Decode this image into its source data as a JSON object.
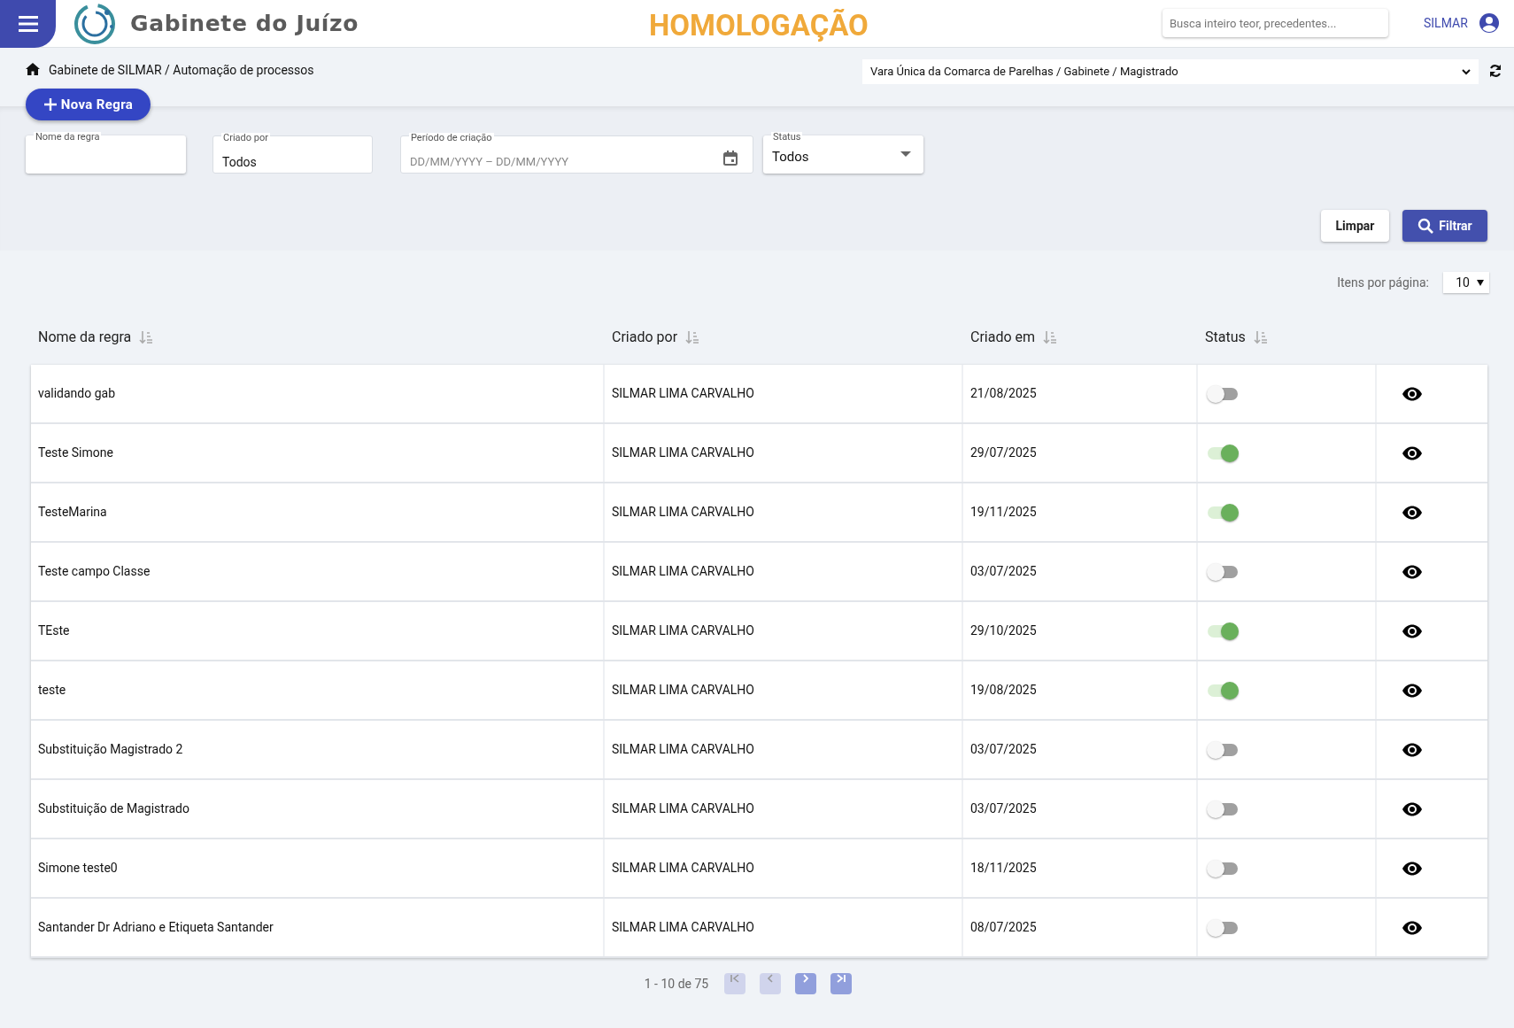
{
  "header": {
    "title": "Gabinete do Juízo",
    "environment": "HOMOLOGAÇÃO",
    "search": {
      "placeholder": "Busca inteiro teor, precedentes..."
    },
    "user": "SILMAR"
  },
  "breadcrumb": "Gabinete de SILMAR / Automação de processos",
  "unit_select": "Vara Única da Comarca de Parelhas / Gabinete / Magistrado",
  "new_button": "Nova Regra",
  "filters": [
    {
      "kind": "text",
      "label": "Nome da regra"
    },
    {
      "kind": "text",
      "label": "Criado por",
      "value": "Todos"
    },
    {
      "kind": "date",
      "label": "Período de criação",
      "placeholder": "DD/MM/YYYY – DD/MM/YYYY"
    },
    {
      "kind": "select",
      "label": "Status",
      "value": "Todos"
    }
  ],
  "actions": [
    "Limpar",
    "Filtrar"
  ],
  "page_size": {
    "label": "Itens por página:",
    "value": "10"
  },
  "table": {
    "columns": [
      "Nome da regra",
      "Criado por",
      "Criado em",
      "Status"
    ],
    "rows": [
      {
        "name": "validando gab",
        "creator": "SILMAR LIMA CARVALHO",
        "date": "21/08/2025",
        "on": false
      },
      {
        "name": "Teste Simone",
        "creator": "SILMAR LIMA CARVALHO",
        "date": "29/07/2025",
        "on": true
      },
      {
        "name": "TesteMarina",
        "creator": "SILMAR LIMA CARVALHO",
        "date": "19/11/2025",
        "on": true
      },
      {
        "name": "Teste campo Classe",
        "creator": "SILMAR LIMA CARVALHO",
        "date": "03/07/2025",
        "on": false
      },
      {
        "name": "TEste",
        "creator": "SILMAR LIMA CARVALHO",
        "date": "29/10/2025",
        "on": true
      },
      {
        "name": "teste",
        "creator": "SILMAR LIMA CARVALHO",
        "date": "19/08/2025",
        "on": true
      },
      {
        "name": "Substituição Magistrado 2",
        "creator": "SILMAR LIMA CARVALHO",
        "date": "03/07/2025",
        "on": false
      },
      {
        "name": "Substituição de Magistrado",
        "creator": "SILMAR LIMA CARVALHO",
        "date": "03/07/2025",
        "on": false
      },
      {
        "name": "Simone teste0",
        "creator": "SILMAR LIMA CARVALHO",
        "date": "18/11/2025",
        "on": false
      },
      {
        "name": "Santander Dr Adriano e Etiqueta Santander",
        "creator": "SILMAR LIMA CARVALHO",
        "date": "08/07/2025",
        "on": false
      }
    ]
  },
  "pagination": {
    "range": "1 - 10 de 75",
    "buttons": [
      {
        "kind": "first",
        "disabled": true
      },
      {
        "kind": "prev",
        "disabled": true
      },
      {
        "kind": "next",
        "disabled": false
      },
      {
        "kind": "last",
        "disabled": false
      }
    ]
  }
}
